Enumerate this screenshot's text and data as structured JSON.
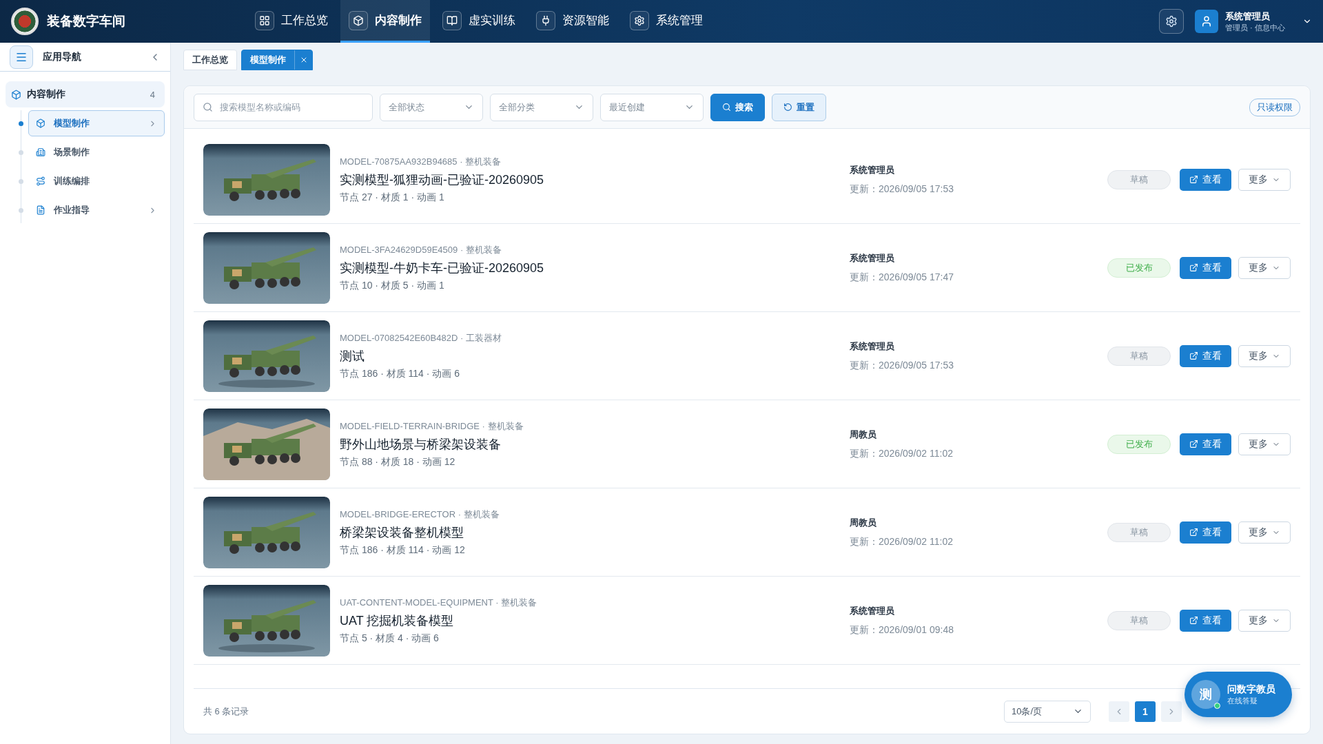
{
  "app": {
    "title": "装备数字车间"
  },
  "nav": [
    {
      "label": "工作总览",
      "selected": false
    },
    {
      "label": "内容制作",
      "selected": true
    },
    {
      "label": "虚实训练",
      "selected": false
    },
    {
      "label": "资源智能",
      "selected": false
    },
    {
      "label": "系统管理",
      "selected": false
    }
  ],
  "user": {
    "name": "系统管理员",
    "role": "管理员 · 信息中心"
  },
  "sidebar": {
    "title": "应用导航",
    "group": {
      "label": "内容制作",
      "count": "4",
      "children": [
        {
          "label": "模型制作",
          "selected": true,
          "expandable": true
        },
        {
          "label": "场景制作",
          "selected": false,
          "expandable": false
        },
        {
          "label": "训练编排",
          "selected": false,
          "expandable": false
        },
        {
          "label": "作业指导",
          "selected": false,
          "expandable": true
        }
      ]
    }
  },
  "tabs": [
    {
      "label": "工作总览",
      "selected": false,
      "closable": false
    },
    {
      "label": "模型制作",
      "selected": true,
      "closable": true
    }
  ],
  "toolbar": {
    "search": {
      "placeholder": "搜索模型名称或编码"
    },
    "filters": [
      "全部状态",
      "全部分类",
      "最近创建"
    ],
    "search_button": "搜索",
    "reset_button": "重置",
    "permission": "只读权限"
  },
  "rows": [
    {
      "code": "MODEL-70875AA932B94685 · 整机装备",
      "name": "实测模型-狐狸动画-已验证-20260905",
      "stats": "节点 27 · 材质 1 · 动画 1",
      "owner": "系统管理员",
      "updated": "更新：2026/09/05 17:53",
      "status": {
        "label": "草稿",
        "kind": "draft"
      },
      "view": "查看",
      "more": "更多"
    },
    {
      "code": "MODEL-3FA24629D59E4509 · 整机装备",
      "name": "实测模型-牛奶卡车-已验证-20260905",
      "stats": "节点 10 · 材质 5 · 动画 1",
      "owner": "系统管理员",
      "updated": "更新：2026/09/05 17:47",
      "status": {
        "label": "已发布",
        "kind": "published"
      },
      "view": "查看",
      "more": "更多"
    },
    {
      "code": "MODEL-07082542E60B482D · 工装器材",
      "name": "测试",
      "stats": "节点 186 · 材质 114 · 动画 6",
      "owner": "系统管理员",
      "updated": "更新：2026/09/05 17:53",
      "status": {
        "label": "草稿",
        "kind": "draft"
      },
      "view": "查看",
      "more": "更多"
    },
    {
      "code": "MODEL-FIELD-TERRAIN-BRIDGE · 整机装备",
      "name": "野外山地场景与桥梁架设装备",
      "stats": "节点 88 · 材质 18 · 动画 12",
      "owner": "周教员",
      "updated": "更新：2026/09/02 11:02",
      "status": {
        "label": "已发布",
        "kind": "published"
      },
      "view": "查看",
      "more": "更多"
    },
    {
      "code": "MODEL-BRIDGE-ERECTOR · 整机装备",
      "name": "桥梁架设装备整机模型",
      "stats": "节点 186 · 材质 114 · 动画 12",
      "owner": "周教员",
      "updated": "更新：2026/09/02 11:02",
      "status": {
        "label": "草稿",
        "kind": "draft"
      },
      "view": "查看",
      "more": "更多"
    },
    {
      "code": "UAT-CONTENT-MODEL-EQUIPMENT · 整机装备",
      "name": "UAT 挖掘机装备模型",
      "stats": "节点 5 · 材质 4 · 动画 6",
      "owner": "系统管理员",
      "updated": "更新：2026/09/01 09:48",
      "status": {
        "label": "草稿",
        "kind": "draft"
      },
      "view": "查看",
      "more": "更多"
    }
  ],
  "footer": {
    "total": "共 6 条记录",
    "page_size": "10条/页",
    "pages": [
      {
        "label": "1",
        "selected": true
      }
    ]
  },
  "assistant": {
    "avatar": "测",
    "title": "问数字教员",
    "subtitle": "在线答疑",
    "online": true
  }
}
